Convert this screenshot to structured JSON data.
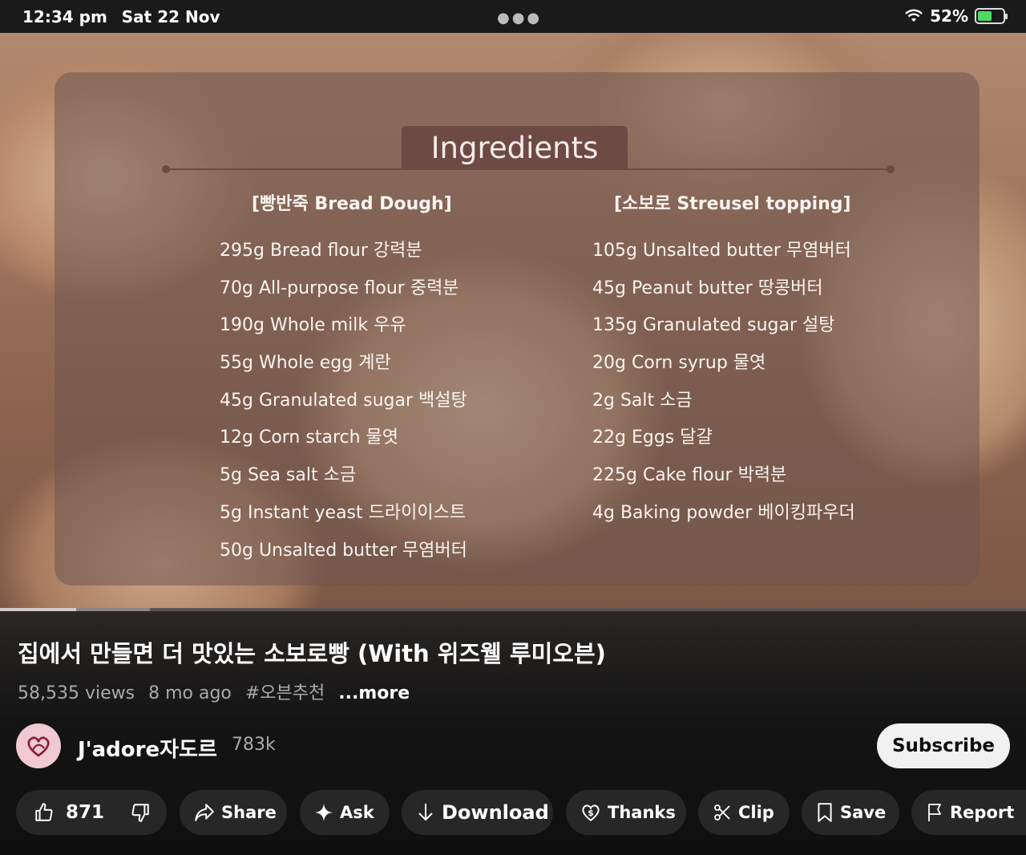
{
  "status_bar": {
    "time": "12:34 pm",
    "date": "Sat 22 Nov",
    "battery": "52%",
    "battery_level": 0.52,
    "accent": "#4cd964"
  },
  "video": {
    "ingredients_title": "Ingredients",
    "left_heading": "[빵반죽 Bread Dough]",
    "left_items": [
      "295g Bread flour 강력분",
      "70g All-purpose flour 중력분",
      "190g Whole milk 우유",
      "55g Whole egg 계란",
      "45g Granulated sugar 백설탕",
      "12g Corn starch 물엿",
      "5g Sea salt 소금",
      "5g Instant yeast 드라이이스트",
      "50g Unsalted butter 무염버터"
    ],
    "right_heading": "[소보로 Streusel topping]",
    "right_items": [
      "105g Unsalted butter 무염버터",
      "45g Peanut butter 땅콩버터",
      "135g Granulated sugar 설탕",
      "20g Corn syrup 물엿",
      "2g Salt 소금",
      "22g Eggs 달걀",
      "225g Cake flour 박력분",
      "4g Baking powder 베이킹파우더"
    ]
  },
  "info": {
    "title": "집에서 만들면 더 맛있는 소보로빵 (With 위즈웰 루미오븐)",
    "views": "58,535 views",
    "age": "8 mo ago",
    "hashtag": "#오븐추천",
    "more": "...more",
    "channel_name": "J'adore자도르",
    "subscribers": "783k",
    "subscribe_label": "Subscribe"
  },
  "actions": {
    "like_count": "871",
    "share": "Share",
    "ask": "Ask",
    "download": "Download",
    "thanks": "Thanks",
    "clip": "Clip",
    "save": "Save",
    "report": "Report"
  }
}
